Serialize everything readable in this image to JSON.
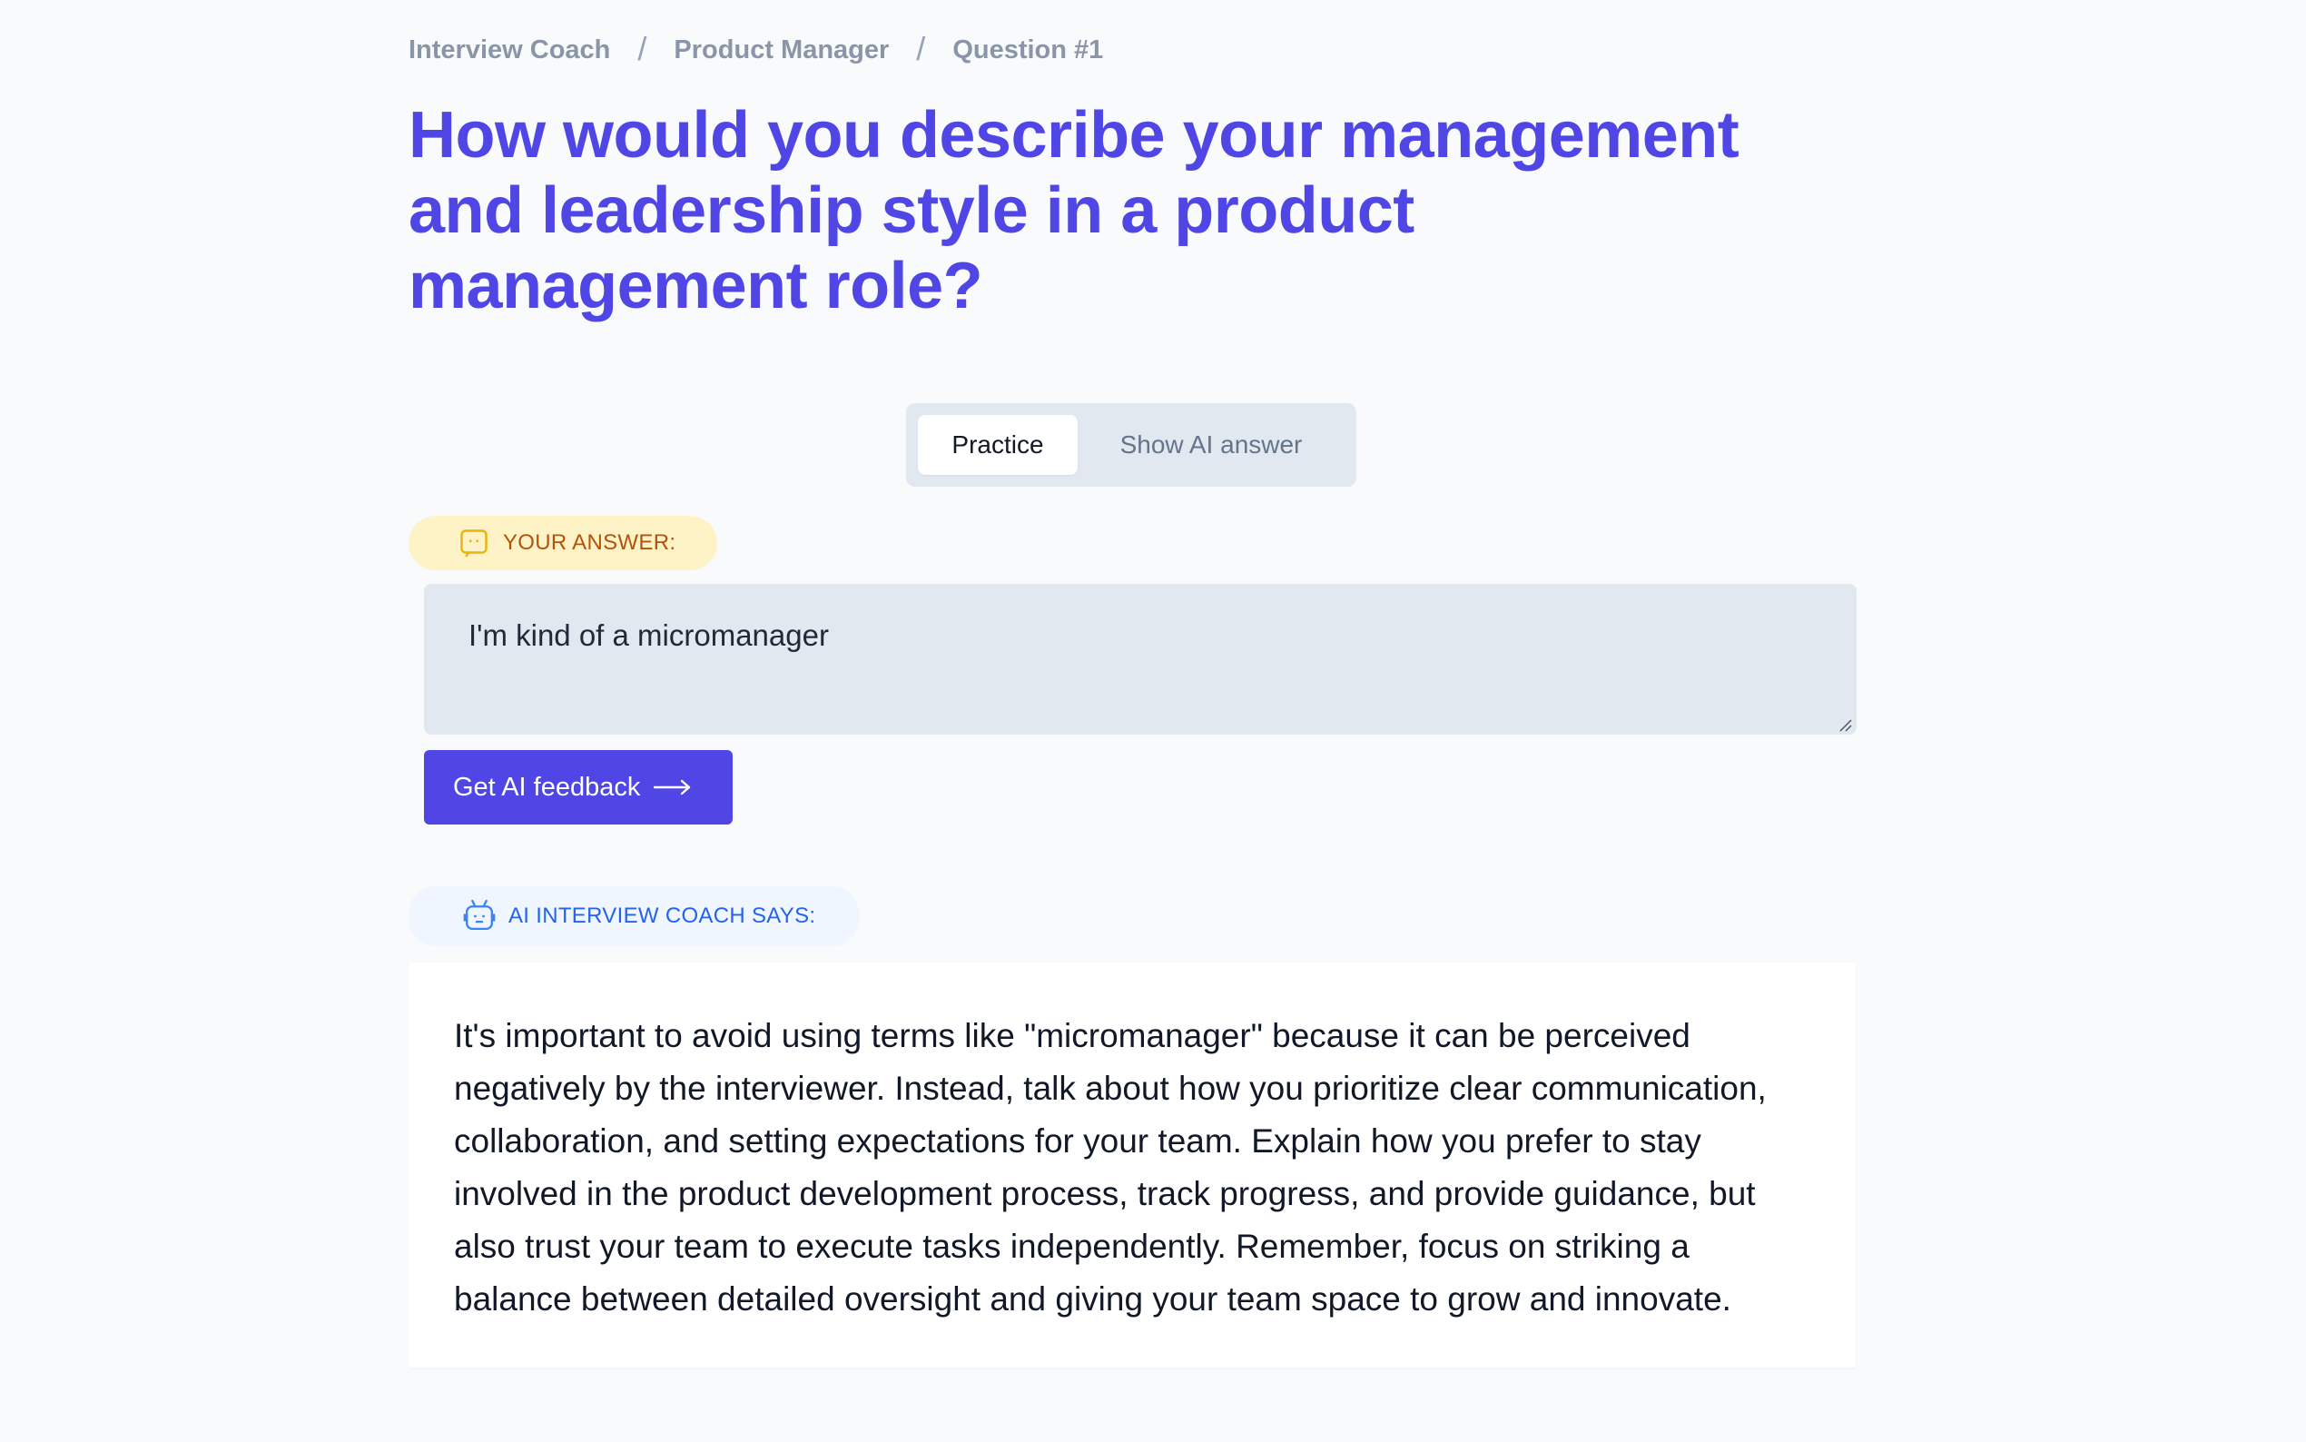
{
  "breadcrumb": {
    "items": [
      "Interview Coach",
      "Product Manager",
      "Question #1"
    ],
    "separator": "/"
  },
  "question": {
    "title": "How would you describe your management and leadership style in a product management role?"
  },
  "tabs": [
    {
      "label": "Practice",
      "active": true
    },
    {
      "label": "Show AI answer",
      "active": false
    }
  ],
  "answer_section": {
    "label": "YOUR ANSWER:",
    "icon": "chat-face-icon",
    "value": "I'm kind of a micromanager"
  },
  "feedback_button": {
    "label": "Get AI feedback",
    "icon": "arrow-right-icon"
  },
  "coach_section": {
    "label": "AI INTERVIEW COACH SAYS:",
    "icon": "robot-icon",
    "feedback": "It's important to avoid using terms like \"micromanager\" because it can be perceived negatively by the interviewer. Instead, talk about how you prioritize clear communication, collaboration, and setting expectations for your team. Explain how you prefer to stay involved in the product development process, track progress, and provide guidance, but also trust your team to execute tasks independently. Remember, focus on striking a balance between detailed oversight and giving your team space to grow and innovate."
  },
  "colors": {
    "accent": "#4f46e5",
    "background": "#f8fafc",
    "answer_pill_bg": "#fef3c7",
    "answer_pill_text": "#b45309",
    "coach_pill_bg": "#eff6ff",
    "coach_pill_text": "#2563eb"
  }
}
